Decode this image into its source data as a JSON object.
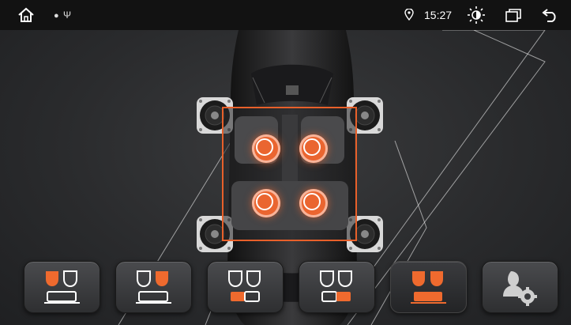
{
  "status_bar": {
    "time": "15:27",
    "icons": [
      "home-icon",
      "android-icon",
      "usb-icon",
      "location-icon",
      "brightness-icon",
      "recent-apps-icon",
      "back-icon"
    ]
  },
  "sound_field": {
    "focus": "center",
    "speakers": [
      "front-left",
      "front-right",
      "rear-left",
      "rear-right"
    ],
    "accent_color": "#e8602a"
  },
  "modes": [
    {
      "name": "driver-seat",
      "active": false
    },
    {
      "name": "front-passenger-seat",
      "active": false
    },
    {
      "name": "rear-left-seat",
      "active": false
    },
    {
      "name": "rear-right-seat",
      "active": false
    },
    {
      "name": "all-seats",
      "active": true
    },
    {
      "name": "user-settings",
      "active": false
    }
  ]
}
